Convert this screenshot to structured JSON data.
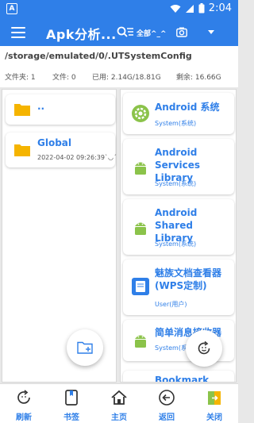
{
  "status_bar": {
    "time": "2:04",
    "notification_letter": "A"
  },
  "app_bar": {
    "title": "Apk分析...",
    "filter_label": "全部^_^"
  },
  "path_panel": {
    "path": "/storage/emulated/0/.UTSystemConfig",
    "folders": "文件夹: 1",
    "files": "文件: 0",
    "used": "已用: 2.14G/18.81G",
    "free": "剩余: 16.66G"
  },
  "folders": [
    {
      "name": "..",
      "date": ""
    },
    {
      "name": "Global",
      "date": "2022-04-02 09:26:39`◡´"
    }
  ],
  "apps": [
    {
      "name": "Android 系统",
      "type": "System(系统)",
      "icon": "gear-icon"
    },
    {
      "name": "Android Services Library",
      "type": "System(系统)",
      "icon": "android-icon"
    },
    {
      "name": "Android Shared Library",
      "type": "System(系统)",
      "icon": "android-icon"
    },
    {
      "name": "魅族文档查看器 (WPS定制)",
      "type": "User(用户)",
      "icon": "document-app-icon"
    },
    {
      "name": "简单消息接收器",
      "type": "System(系统)",
      "icon": "android-icon"
    },
    {
      "name": "Bookmark",
      "type": "",
      "icon": "android-icon"
    }
  ],
  "bottom_nav": {
    "refresh": "刷新",
    "bookmarks": "书签",
    "home": "主页",
    "back": "返回",
    "close": "关闭"
  },
  "colors": {
    "primary": "#2f7fe8",
    "folder": "#f5b400",
    "android": "#8bc34a"
  }
}
